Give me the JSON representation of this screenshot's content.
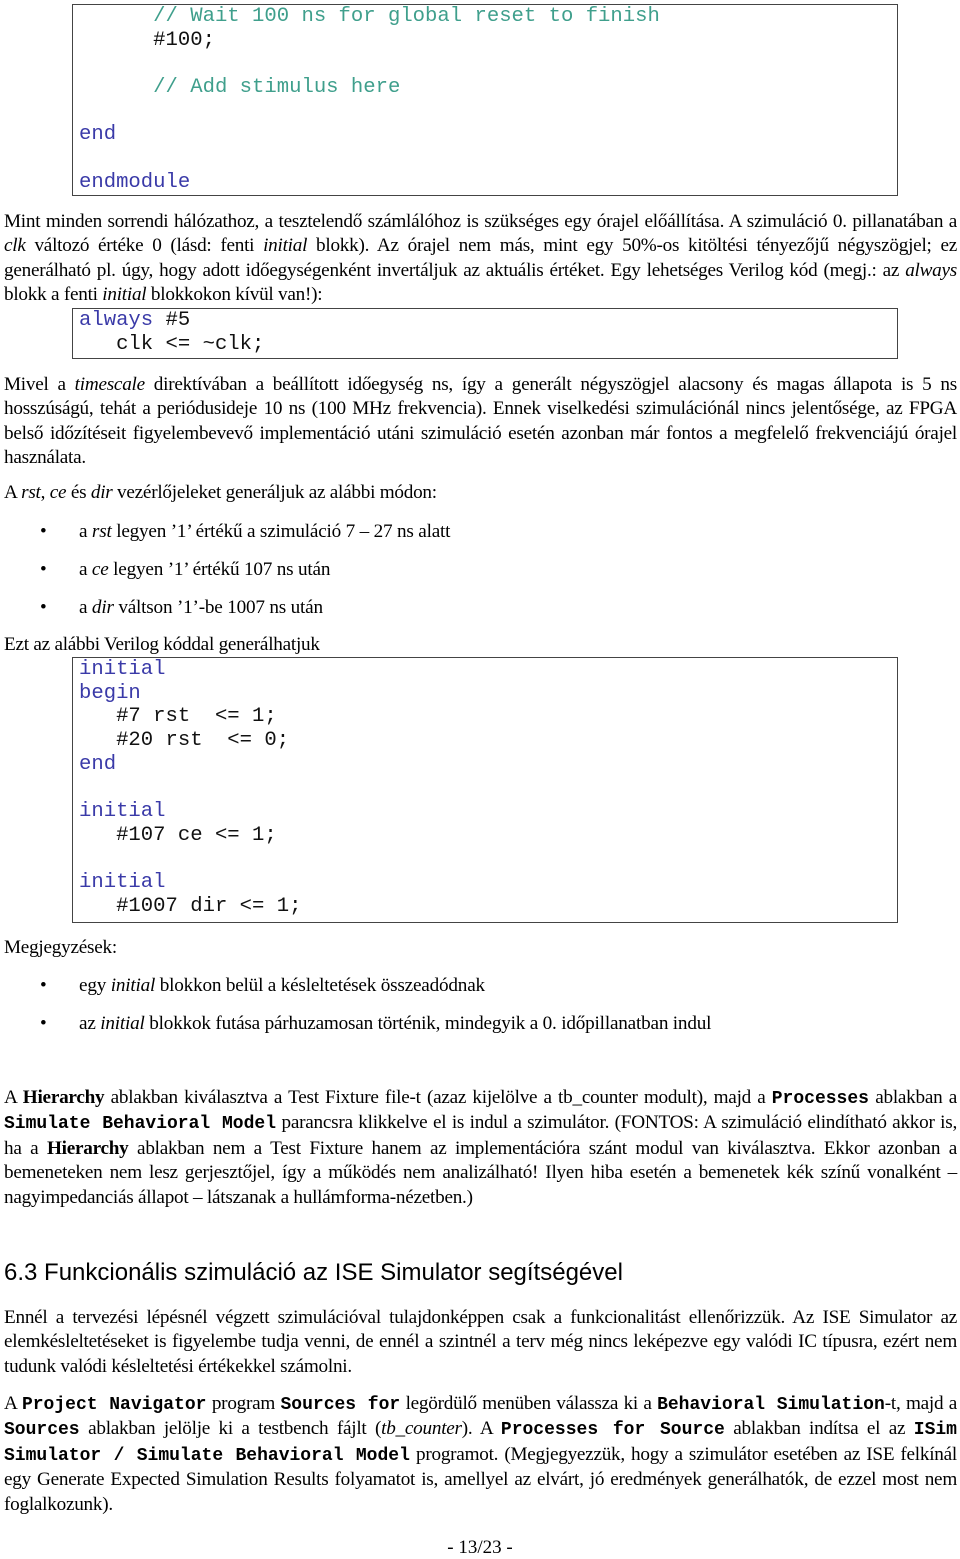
{
  "code_blocks": [
    {
      "lines": [
        [
          {
            "t": "      "
          },
          {
            "t": "// Wait 100 ns for global reset to finish",
            "k": "cm"
          }
        ],
        [
          {
            "t": "      #100;"
          }
        ],
        [
          {
            "t": ""
          }
        ],
        [
          {
            "t": "      "
          },
          {
            "t": "// Add stimulus here",
            "k": "cm"
          }
        ],
        [
          {
            "t": ""
          }
        ],
        [
          {
            "t": "end",
            "k": "kw"
          }
        ],
        [
          {
            "t": ""
          }
        ],
        [
          {
            "t": "endmodule",
            "k": "kw"
          }
        ]
      ]
    },
    {
      "lines": [
        [
          {
            "t": "always",
            "k": "kw"
          },
          {
            "t": " #5"
          }
        ],
        [
          {
            "t": "   clk <= ~clk;"
          }
        ]
      ]
    },
    {
      "lines": [
        [
          {
            "t": "initial",
            "k": "kw"
          }
        ],
        [
          {
            "t": "begin",
            "k": "kw"
          }
        ],
        [
          {
            "t": "   #7 rst  <= 1;"
          }
        ],
        [
          {
            "t": "   #20 rst  <= 0;"
          }
        ],
        [
          {
            "t": "end",
            "k": "kw"
          }
        ],
        [
          {
            "t": ""
          }
        ],
        [
          {
            "t": "initial",
            "k": "kw"
          }
        ],
        [
          {
            "t": "   #107 ce <= 1;"
          }
        ],
        [
          {
            "t": ""
          }
        ],
        [
          {
            "t": "initial",
            "k": "kw"
          }
        ],
        [
          {
            "t": "   #1007 dir <= 1;"
          }
        ]
      ]
    }
  ],
  "paragraphs": [
    [
      {
        "t": "Mint minden sorrendi hálózathoz, a tesztelendő számlálóhoz is szükséges egy órajel előállítása. A szimuláció 0. pillanatában a "
      },
      {
        "t": "clk",
        "s": "i"
      },
      {
        "t": " változó értéke 0 (lásd: fenti "
      },
      {
        "t": "initial",
        "s": "i"
      },
      {
        "t": " blokk). Az órajel nem más, mint egy 50%-os kitöltési tényezőjű négyszögjel; ez generálható pl. úgy, hogy adott időegységenként invertáljuk az aktuális értéket. Egy lehetséges Verilog kód (megj.: az "
      },
      {
        "t": "always",
        "s": "i"
      },
      {
        "t": " blokk a fenti "
      },
      {
        "t": "initial",
        "s": "i"
      },
      {
        "t": " blokkokon kívül van!):"
      }
    ],
    [
      {
        "t": "Mivel a "
      },
      {
        "t": "timescale",
        "s": "i"
      },
      {
        "t": " direktívában a beállított időegység ns, így a generált négyszögjel alacsony és magas állapota is 5 ns hosszúságú, tehát a periódusideje 10 ns (100 MHz frekvencia). Ennek viselkedési szimulációnál nincs jelentősége, az FPGA belső időzítéseit figyelembevevő implementáció utáni szimuláció esetén azonban már fontos a megfelelő frekvenciájú órajel használata."
      }
    ],
    [
      {
        "t": "A "
      },
      {
        "t": "rst",
        "s": "i"
      },
      {
        "t": ", "
      },
      {
        "t": "ce",
        "s": "i"
      },
      {
        "t": " és "
      },
      {
        "t": "dir",
        "s": "i"
      },
      {
        "t": " vezérlőjeleket generáljuk az alábbi módon:"
      }
    ],
    [
      {
        "t": "Ezt az alábbi Verilog kóddal generálhatjuk"
      }
    ],
    [
      {
        "t": "Megjegyzések:"
      }
    ],
    [
      {
        "t": "A "
      },
      {
        "t": "Hierarchy",
        "s": "b"
      },
      {
        "t": " ablakban kiválasztva a Test Fixture file-t (azaz kijelölve a tb_counter modult), majd a "
      },
      {
        "t": "Processes",
        "s": "code"
      },
      {
        "t": " ablakban a "
      },
      {
        "t": "Simulate Behavioral Model",
        "s": "code"
      },
      {
        "t": " parancsra klikkelve el is indul a szimulátor. (FONTOS: A szimuláció elindítható akkor is, ha a "
      },
      {
        "t": "Hierarchy",
        "s": "b"
      },
      {
        "t": " ablakban nem a Test Fixture hanem az implementációra szánt modul van kiválasztva. Ekkor azonban a bemeneteken nem lesz gerjesztőjel, így a működés nem analizálható! Ilyen hiba esetén a bemenetek kék színű vonalként – nagyimpedanciás állapot – látszanak a hullámforma-nézetben.)"
      }
    ],
    [
      {
        "t": "Ennél a tervezési lépésnél végzett szimulációval tulajdonképpen csak a funkcionalitást ellenőrizzük. Az ISE Simulator az elemkésleltetéseket is figyelembe tudja venni, de ennél a szintnél a terv még nincs leképezve egy valódi IC típusra, ezért nem tudunk valódi késleltetési értékekkel számolni."
      }
    ],
    [
      {
        "t": "A "
      },
      {
        "t": "Project Navigator",
        "s": "code"
      },
      {
        "t": " program "
      },
      {
        "t": "Sources for",
        "s": "code"
      },
      {
        "t": " legördülő menüben válassza ki a "
      },
      {
        "t": "Behavioral Simulation",
        "s": "code"
      },
      {
        "t": "-t, majd a "
      },
      {
        "t": "Sources",
        "s": "code"
      },
      {
        "t": " ablakban jelölje ki a testbench fájlt ("
      },
      {
        "t": "tb_counter",
        "s": "i"
      },
      {
        "t": "). A "
      },
      {
        "t": "Processes for Source",
        "s": "code"
      },
      {
        "t": " ablakban indítsa el az "
      },
      {
        "t": "ISim Simulator / Simulate Behavioral Model",
        "s": "code"
      },
      {
        "t": " programot. (Megjegyezzük, hogy a szimulátor esetében az ISE felkínál egy Generate Expected Simulation Results folyamatot is, amellyel az elvárt, jó eredmények generálhatók, de ezzel most nem foglalkozunk)."
      }
    ]
  ],
  "bullets": [
    [
      {
        "t": "a "
      },
      {
        "t": "rst",
        "s": "i"
      },
      {
        "t": " legyen ’1’ értékű a szimuláció 7 – 27 ns alatt"
      }
    ],
    [
      {
        "t": "a "
      },
      {
        "t": "ce",
        "s": "i"
      },
      {
        "t": " legyen ’1’ értékű 107 ns után"
      }
    ],
    [
      {
        "t": "a "
      },
      {
        "t": "dir",
        "s": "i"
      },
      {
        "t": " váltson ’1’-be 1007 ns után"
      }
    ],
    [
      {
        "t": "egy "
      },
      {
        "t": "initial",
        "s": "i"
      },
      {
        "t": " blokkon belül a késleltetések összeadódnak"
      }
    ],
    [
      {
        "t": "az "
      },
      {
        "t": "initial",
        "s": "i"
      },
      {
        "t": " blokkok futása párhuzamosan történik, mindegyik a 0. időpillanatban indul"
      }
    ]
  ],
  "bullet_symbol": "•",
  "heading": "6.3  Funkcionális szimuláció az ISE Simulator segítségével",
  "footer": "- 13/23 -",
  "colors": {
    "keyword": "#3a3aa8",
    "comment": "#3f9f8c"
  }
}
